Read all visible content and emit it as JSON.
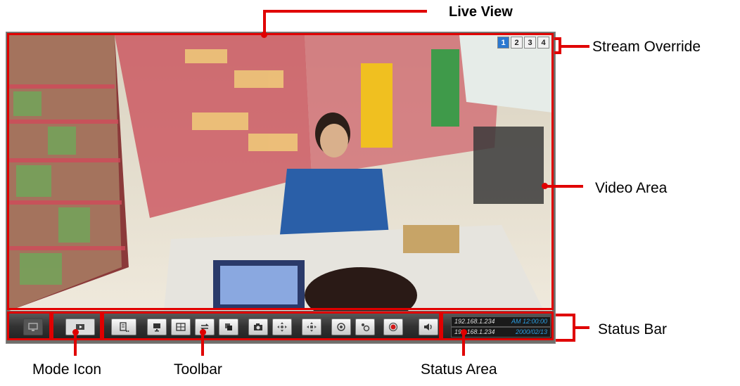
{
  "callouts": {
    "live_view": "Live View",
    "stream_override": "Stream Override",
    "video_area": "Video Area",
    "status_bar": "Status Bar",
    "mode_icon": "Mode Icon",
    "toolbar": "Toolbar",
    "status_area": "Status Area"
  },
  "stream_override": {
    "buttons": [
      "1",
      "2",
      "3",
      "4"
    ],
    "active_index": 0
  },
  "toolbar": {
    "mode_icons": [
      "monitor-icon",
      "play-mode-icon"
    ],
    "tools": [
      "list-more-icon",
      "display-icon",
      "layout-grid-icon",
      "swap-icon",
      "window-icon",
      "snapshot-icon",
      "ptz-move-icon",
      "ptz-zoom-icon",
      "focus-icon",
      "preset-icon",
      "record-icon",
      "speaker-icon"
    ]
  },
  "status": {
    "rows": [
      {
        "ip": "192.168.1.234",
        "value": "AM 12:00:00"
      },
      {
        "ip": "192.168.1.234",
        "value": "2000/02/13"
      }
    ]
  },
  "colors": {
    "annotation": "#e00000",
    "status_text": "#2a9de0",
    "active_stream": "#2b78d0"
  }
}
